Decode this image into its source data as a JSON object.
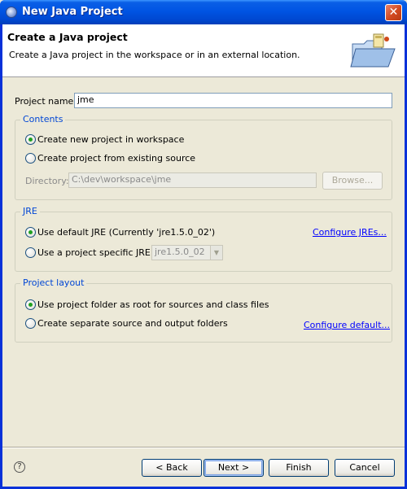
{
  "window": {
    "title": "New Java Project"
  },
  "header": {
    "title": "Create a Java project",
    "description": "Create a Java project in the workspace or in an external location."
  },
  "project_name": {
    "label": "Project name:",
    "value": "jme"
  },
  "contents": {
    "title": "Contents",
    "option_new": "Create new project in workspace",
    "option_existing": "Create project from existing source",
    "directory_label": "Directory:",
    "directory_value": "C:\\dev\\workspace\\jme",
    "browse_label": "Browse..."
  },
  "jre": {
    "title": "JRE",
    "option_default": "Use default JRE (Currently 'jre1.5.0_02')",
    "configure_link": "Configure JREs...",
    "option_specific": "Use a project specific JRE:",
    "specific_value": "jre1.5.0_02"
  },
  "layout": {
    "title": "Project layout",
    "option_root": "Use project folder as root for sources and class files",
    "option_separate": "Create separate source and output folders",
    "configure_link": "Configure default..."
  },
  "buttons": {
    "back": "< Back",
    "next": "Next >",
    "finish": "Finish",
    "cancel": "Cancel",
    "help": "?"
  }
}
